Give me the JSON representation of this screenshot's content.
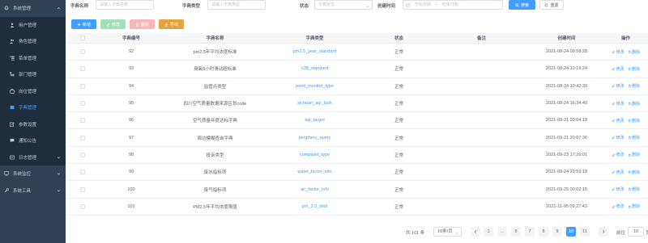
{
  "sidebar": {
    "items": [
      {
        "label": "系统管理",
        "icon": "gear-icon",
        "level": "group"
      },
      {
        "label": "用户管理",
        "icon": "user-icon",
        "level": "sub"
      },
      {
        "label": "角色管理",
        "icon": "role-icon",
        "level": "sub"
      },
      {
        "label": "菜单管理",
        "icon": "tree-table-icon",
        "level": "sub"
      },
      {
        "label": "部门管理",
        "icon": "tree-icon",
        "level": "sub"
      },
      {
        "label": "岗位管理",
        "icon": "post-icon",
        "level": "sub"
      },
      {
        "label": "字典管理",
        "icon": "dict-icon",
        "level": "sub",
        "active": true
      },
      {
        "label": "参数设置",
        "icon": "edit-icon",
        "level": "sub"
      },
      {
        "label": "通知公告",
        "icon": "message-icon",
        "level": "sub"
      },
      {
        "label": "日志管理",
        "icon": "log-icon",
        "level": "sub"
      },
      {
        "label": "系统监控",
        "icon": "monitor-icon",
        "level": "group"
      },
      {
        "label": "系统工具",
        "icon": "tool-icon",
        "level": "group"
      }
    ]
  },
  "search": {
    "dict_name_label": "字典名称",
    "dict_name_placeholder": "请输入字典名称",
    "dict_type_label": "字典类型",
    "dict_type_placeholder": "请输入字典类型",
    "status_label": "状态",
    "status_placeholder": "字典状态",
    "created_label": "创建时间",
    "start_placeholder": "开始日期",
    "range_sep": "-",
    "end_placeholder": "结束日期",
    "search_button": "搜索",
    "reset_button": "重置"
  },
  "toolbar": {
    "add_label": "新增",
    "edit_label": "修改",
    "delete_label": "删除",
    "export_label": "导出"
  },
  "table": {
    "headers": {
      "code": "字典编号",
      "name": "字典名称",
      "type": "字典类型",
      "status": "状态",
      "remark": "备注",
      "created": "创建时间",
      "actions": "操作"
    },
    "edit_label": "修改",
    "delete_label": "删除",
    "rows": [
      {
        "code": "92",
        "name": "pm2.5年平均浓度标准",
        "type": "pm2.5_year_standard",
        "status": "正常",
        "remark": "",
        "created": "2021-08-24 09:58:28"
      },
      {
        "code": "93",
        "name": "臭氧8小时滑动超标准",
        "type": "o38_standard",
        "status": "正常",
        "remark": "",
        "created": "2021-08-24 10:19:24"
      },
      {
        "code": "94",
        "name": "监管点类型",
        "type": "point_monitor_type",
        "status": "正常",
        "remark": "",
        "created": "2021-08-24 10:42:39"
      },
      {
        "code": "95",
        "name": "四川空气质量数据来源区划code",
        "type": "sichuan_aqi_task",
        "status": "正常",
        "remark": "",
        "created": "2021-08-24 16:34:40"
      },
      {
        "code": "96",
        "name": "空气质量年度达标字典",
        "type": "aqi_target",
        "status": "正常",
        "remark": "",
        "created": "2021-09-21 20:04:18"
      },
      {
        "code": "97",
        "name": "周边模糊查询字典",
        "type": "periphery_query",
        "status": "正常",
        "remark": "",
        "created": "2021-09-21 20:07:36"
      },
      {
        "code": "98",
        "name": "投诉类型",
        "type": "complaint_type",
        "status": "正常",
        "remark": "",
        "created": "2021-09-23 17:26:01"
      },
      {
        "code": "99",
        "name": "废水指标项",
        "type": "water_factor_info",
        "status": "正常",
        "remark": "",
        "created": "2021-09-24 23:59:18"
      },
      {
        "code": "100",
        "name": "废气指标项",
        "type": "air_factor_info",
        "status": "正常",
        "remark": "",
        "created": "2021-09-25 00:02:15"
      },
      {
        "code": "101",
        "name": "PM2.5年平均浓度限值",
        "type": "pm_2.5_limit",
        "status": "正常",
        "remark": "",
        "created": "2021-11-05 09:27:43"
      }
    ]
  },
  "pagination": {
    "total": "共 101 条",
    "page_size": "10条/页",
    "pages": [
      "1",
      "...",
      "6",
      "7",
      "8",
      "9",
      "10",
      "11"
    ],
    "current": "10",
    "goto_label": "前往",
    "goto_value": "10",
    "page_suffix": "页"
  },
  "colors": {
    "sidebar_bg": "#304156",
    "submenu_bg": "#1f2d3d",
    "primary": "#409eff",
    "success_light": "#a3e0b8",
    "danger_light": "#f9b6b6",
    "warning": "#e6a23c"
  }
}
